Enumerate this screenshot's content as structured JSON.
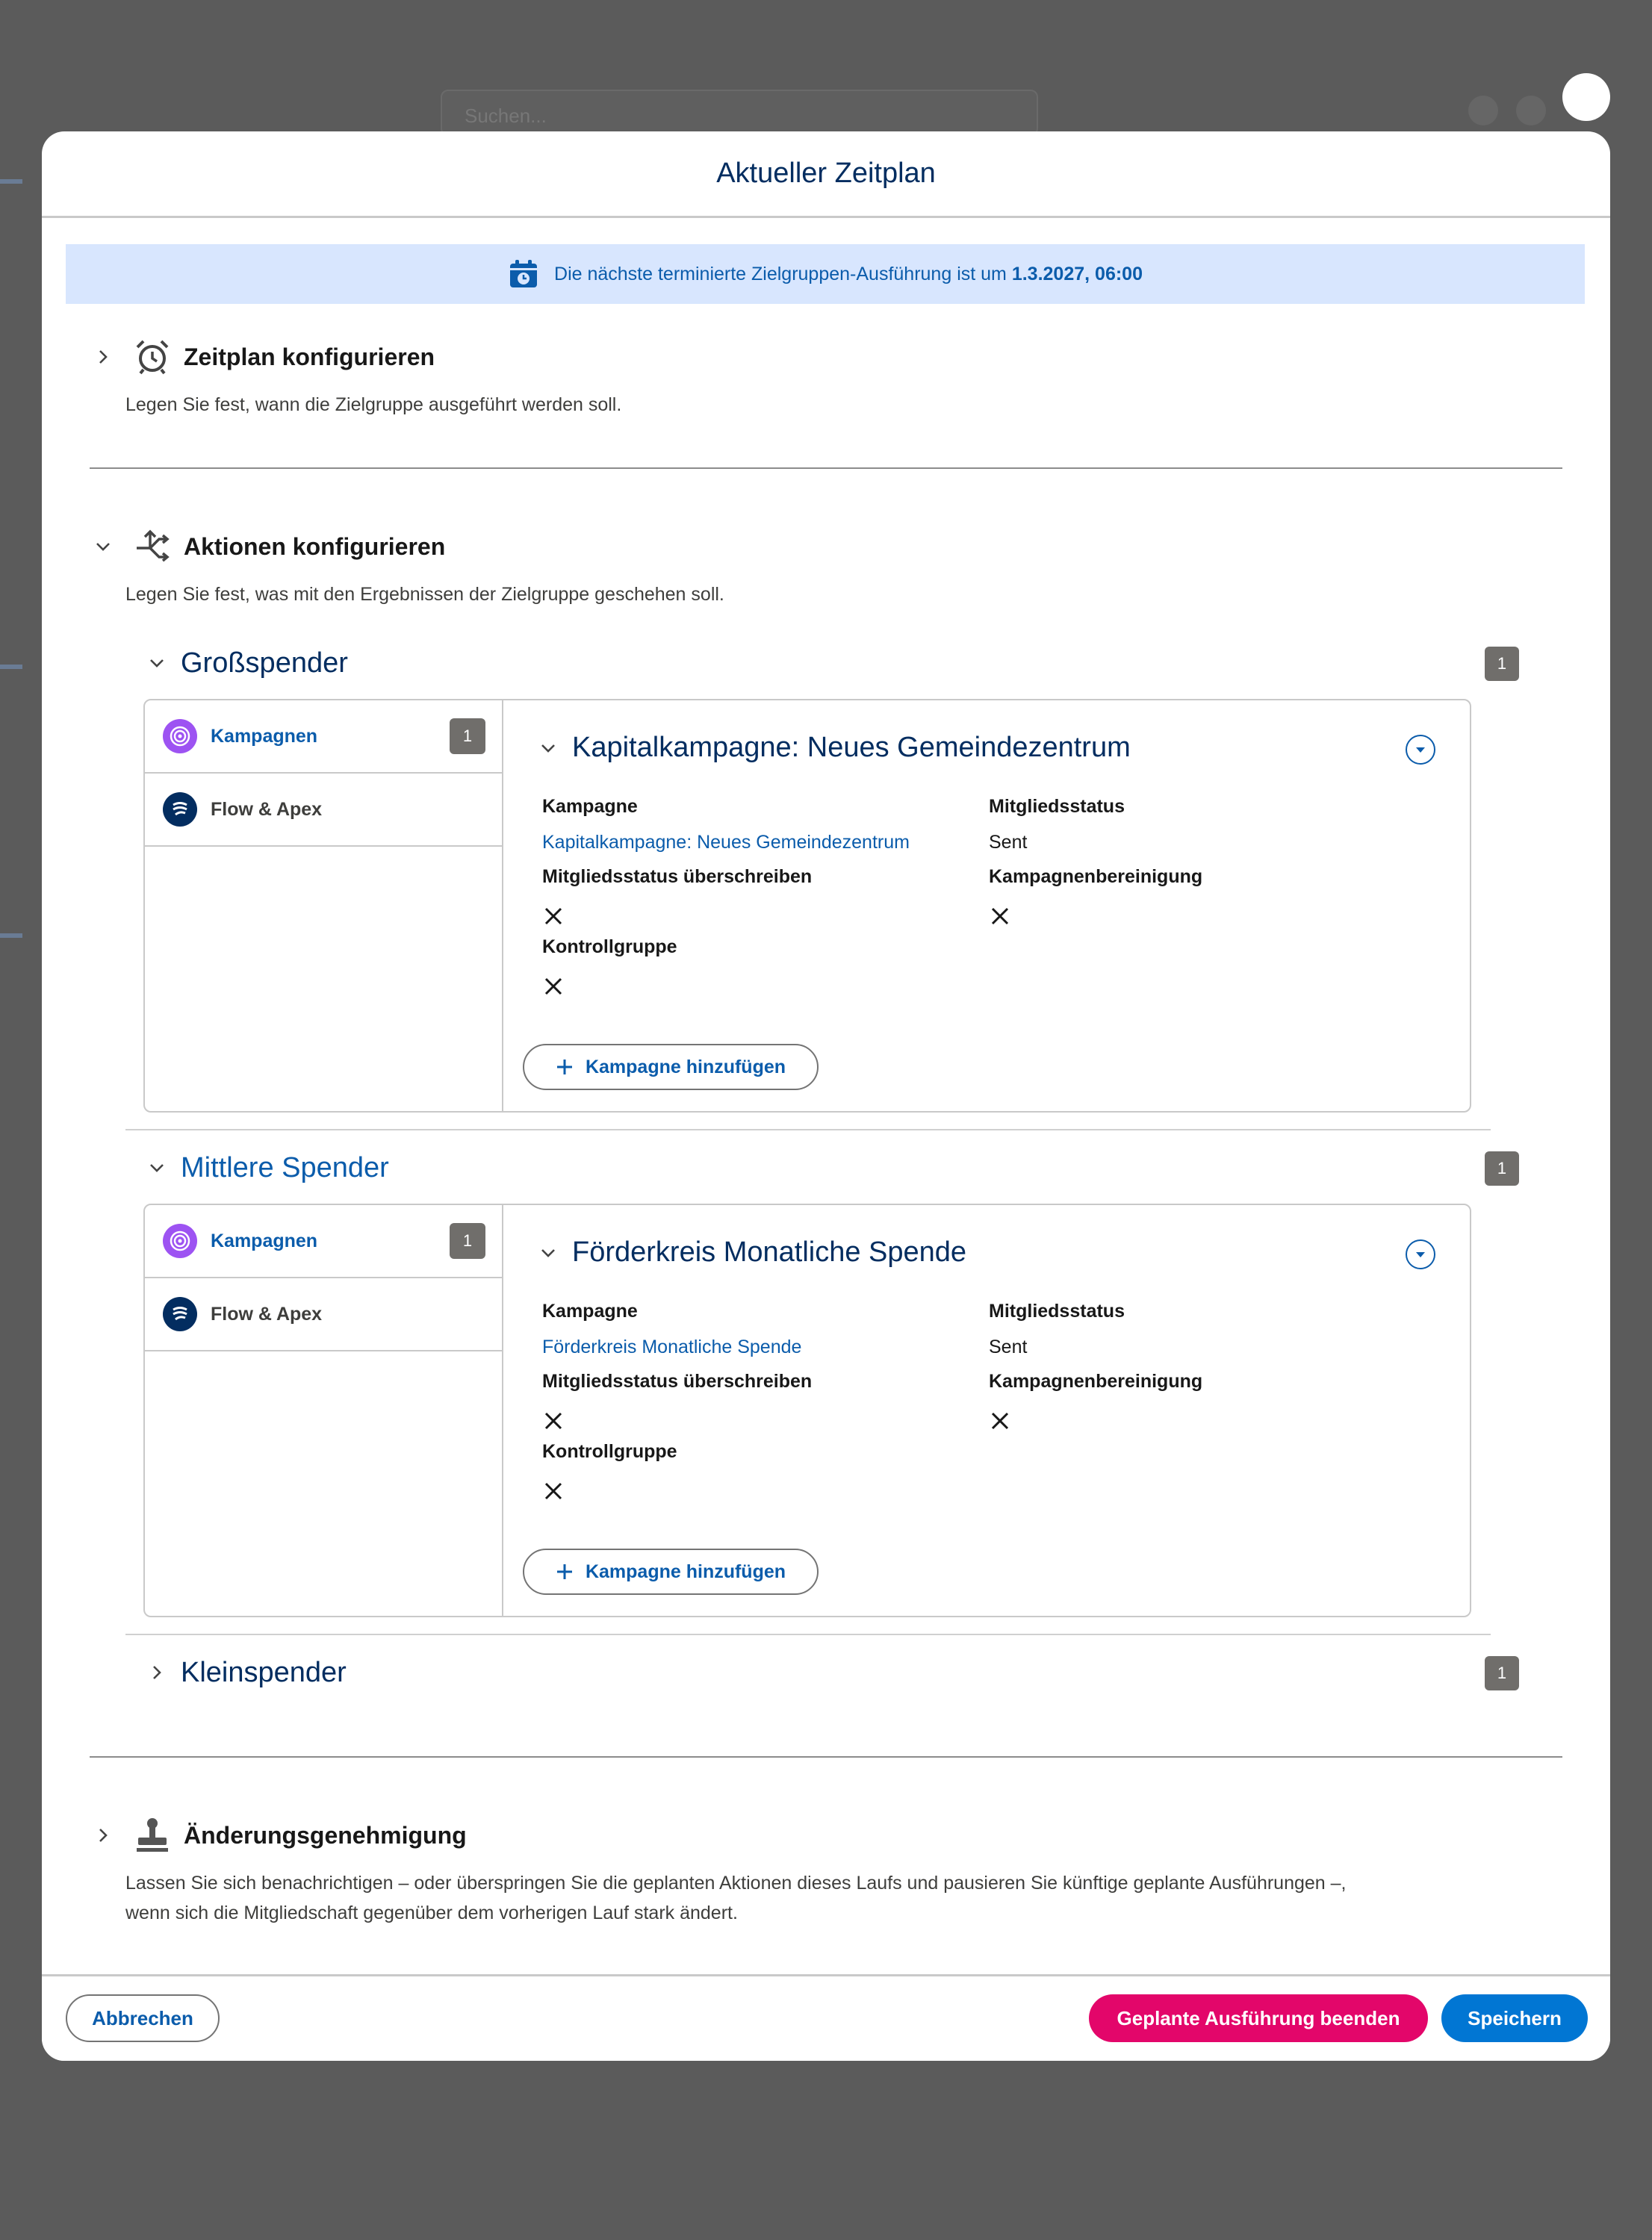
{
  "background": {
    "search_placeholder": "Suchen..."
  },
  "modal": {
    "title": "Aktueller Zeitplan",
    "banner": {
      "text": "Die nächste terminierte Zielgruppen-Ausführung ist um",
      "datetime": "1.3.2027, 06:00"
    },
    "sections": {
      "schedule": {
        "title": "Zeitplan konfigurieren",
        "description": "Legen Sie fest, wann die Zielgruppe ausgeführt werden soll."
      },
      "actions": {
        "title": "Aktionen konfigurieren",
        "description": "Legen Sie fest, was mit den Ergebnissen der Zielgruppe geschehen soll."
      },
      "approval": {
        "title": "Änderungsgenehmigung",
        "description_line1": "Lassen Sie sich benachrichtigen – oder überspringen Sie die geplanten Aktionen dieses Laufs und pausieren Sie künftige geplante Ausführungen –,",
        "description_line2": "wenn sich die Mitgliedschaft gegenüber dem vorherigen Lauf stark ändert."
      }
    },
    "groups": [
      {
        "name": "Großspender",
        "count": "1",
        "tabs": [
          {
            "label": "Kampagnen",
            "count": "1"
          },
          {
            "label": "Flow & Apex"
          }
        ],
        "campaign_title": "Kapitalkampagne: Neues Gemeindezentrum",
        "fields": {
          "campaign_label": "Kampagne",
          "campaign_value": "Kapitalkampagne: Neues Gemeindezentrum",
          "status_label": "Mitgliedsstatus",
          "status_value": "Sent",
          "override_label": "Mitgliedsstatus überschreiben",
          "cleanup_label": "Kampagnenbereinigung",
          "control_label": "Kontrollgruppe"
        },
        "add_label": "Kampagne hinzufügen"
      },
      {
        "name": "Mittlere Spender",
        "count": "1",
        "tabs": [
          {
            "label": "Kampagnen",
            "count": "1"
          },
          {
            "label": "Flow & Apex"
          }
        ],
        "campaign_title": "Förderkreis Monatliche Spende",
        "fields": {
          "campaign_label": "Kampagne",
          "campaign_value": "Förderkreis Monatliche Spende",
          "status_label": "Mitgliedsstatus",
          "status_value": "Sent",
          "override_label": "Mitgliedsstatus überschreiben",
          "cleanup_label": "Kampagnenbereinigung",
          "control_label": "Kontrollgruppe"
        },
        "add_label": "Kampagne hinzufügen"
      },
      {
        "name": "Kleinspender",
        "count": "1"
      }
    ],
    "footer": {
      "cancel": "Abbrechen",
      "stop": "Geplante Ausführung beenden",
      "save": "Speichern"
    }
  },
  "colors": {
    "brand_blue": "#0176d3",
    "link_blue": "#0b5cab",
    "heading_navy": "#032d60",
    "stop_pink": "#e3066a",
    "banner_bg": "#d8e6fe",
    "badge_gray": "#706e6b"
  },
  "icons": [
    "calendar-icon",
    "alarm-clock-icon",
    "actions-branch-icon",
    "approval-stamp-icon",
    "campaign-target-icon",
    "flow-icon",
    "chevron-right-icon",
    "chevron-down-icon",
    "close-x-icon",
    "plus-icon",
    "dropdown-menu-icon"
  ]
}
